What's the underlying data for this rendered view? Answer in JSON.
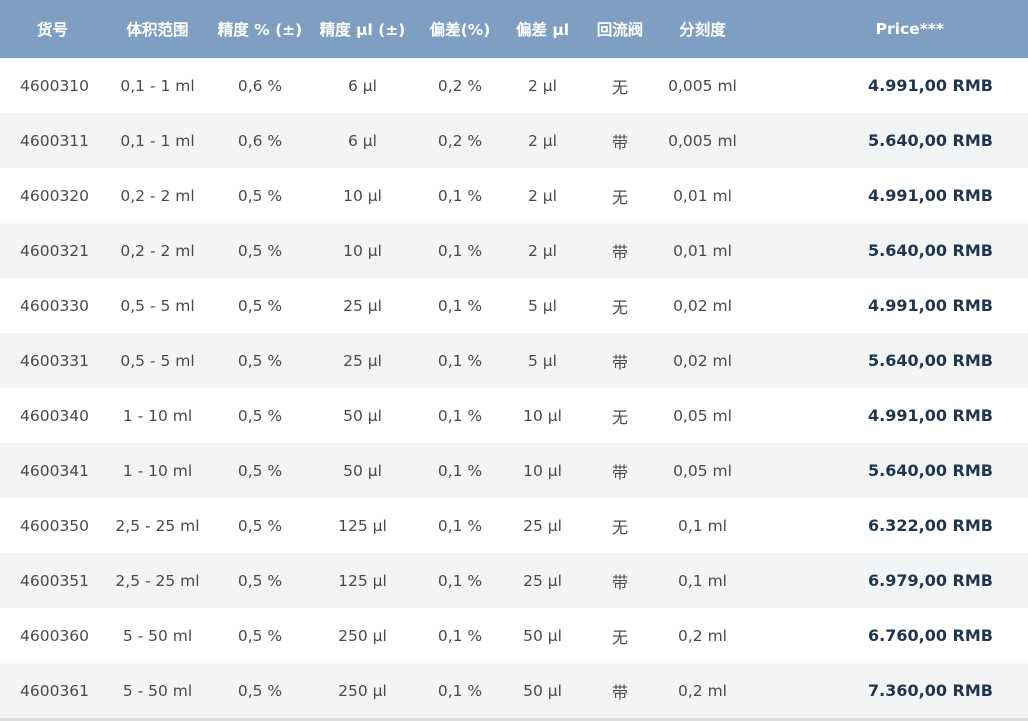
{
  "headers": {
    "sku": "货号",
    "range": "体积范围",
    "precision_pct": "精度 % (±)",
    "precision_ul": "精度 µl (±)",
    "deviation_pct": "偏差(%)",
    "deviation_ul": "偏差 µl",
    "valve": "回流阀",
    "graduation": "分刻度",
    "price": "Price***"
  },
  "rows": [
    {
      "sku": "4600310",
      "range": "0,1 - 1 ml",
      "precision_pct": "0,6 %",
      "precision_ul": "6 µl",
      "deviation_pct": "0,2 %",
      "deviation_ul": "2 µl",
      "valve": "无",
      "graduation": "0,005 ml",
      "price": "4.991,00 RMB"
    },
    {
      "sku": "4600311",
      "range": "0,1 - 1 ml",
      "precision_pct": "0,6 %",
      "precision_ul": "6 µl",
      "deviation_pct": "0,2 %",
      "deviation_ul": "2 µl",
      "valve": "带",
      "graduation": "0,005 ml",
      "price": "5.640,00 RMB"
    },
    {
      "sku": "4600320",
      "range": "0,2 - 2 ml",
      "precision_pct": "0,5 %",
      "precision_ul": "10 µl",
      "deviation_pct": "0,1 %",
      "deviation_ul": "2 µl",
      "valve": "无",
      "graduation": "0,01 ml",
      "price": "4.991,00 RMB"
    },
    {
      "sku": "4600321",
      "range": "0,2 - 2 ml",
      "precision_pct": "0,5 %",
      "precision_ul": "10 µl",
      "deviation_pct": "0,1 %",
      "deviation_ul": "2 µl",
      "valve": "带",
      "graduation": "0,01 ml",
      "price": "5.640,00 RMB"
    },
    {
      "sku": "4600330",
      "range": "0,5 - 5 ml",
      "precision_pct": "0,5 %",
      "precision_ul": "25 µl",
      "deviation_pct": "0,1 %",
      "deviation_ul": "5 µl",
      "valve": "无",
      "graduation": "0,02 ml",
      "price": "4.991,00 RMB"
    },
    {
      "sku": "4600331",
      "range": "0,5 - 5 ml",
      "precision_pct": "0,5 %",
      "precision_ul": "25 µl",
      "deviation_pct": "0,1 %",
      "deviation_ul": "5 µl",
      "valve": "带",
      "graduation": "0,02 ml",
      "price": "5.640,00 RMB"
    },
    {
      "sku": "4600340",
      "range": "1 - 10 ml",
      "precision_pct": "0,5 %",
      "precision_ul": "50 µl",
      "deviation_pct": "0,1 %",
      "deviation_ul": "10 µl",
      "valve": "无",
      "graduation": "0,05 ml",
      "price": "4.991,00 RMB"
    },
    {
      "sku": "4600341",
      "range": "1 - 10 ml",
      "precision_pct": "0,5 %",
      "precision_ul": "50 µl",
      "deviation_pct": "0,1 %",
      "deviation_ul": "10 µl",
      "valve": "带",
      "graduation": "0,05 ml",
      "price": "5.640,00 RMB"
    },
    {
      "sku": "4600350",
      "range": "2,5 - 25 ml",
      "precision_pct": "0,5 %",
      "precision_ul": "125 µl",
      "deviation_pct": "0,1 %",
      "deviation_ul": "25 µl",
      "valve": "无",
      "graduation": "0,1 ml",
      "price": "6.322,00 RMB"
    },
    {
      "sku": "4600351",
      "range": "2,5 - 25 ml",
      "precision_pct": "0,5 %",
      "precision_ul": "125 µl",
      "deviation_pct": "0,1 %",
      "deviation_ul": "25 µl",
      "valve": "带",
      "graduation": "0,1 ml",
      "price": "6.979,00 RMB"
    },
    {
      "sku": "4600360",
      "range": "5 - 50 ml",
      "precision_pct": "0,5 %",
      "precision_ul": "250 µl",
      "deviation_pct": "0,1 %",
      "deviation_ul": "50 µl",
      "valve": "无",
      "graduation": "0,2 ml",
      "price": "6.760,00 RMB"
    },
    {
      "sku": "4600361",
      "range": "5 - 50 ml",
      "precision_pct": "0,5 %",
      "precision_ul": "250 µl",
      "deviation_pct": "0,1 %",
      "deviation_ul": "50 µl",
      "valve": "带",
      "graduation": "0,2 ml",
      "price": "7.360,00 RMB"
    }
  ],
  "colors": {
    "header_background": "#7e9fc2",
    "header_text": "#ffffff",
    "row_alt_background": "#f3f4f5",
    "body_text": "#4a4a4a",
    "price_text": "#1f3550"
  }
}
